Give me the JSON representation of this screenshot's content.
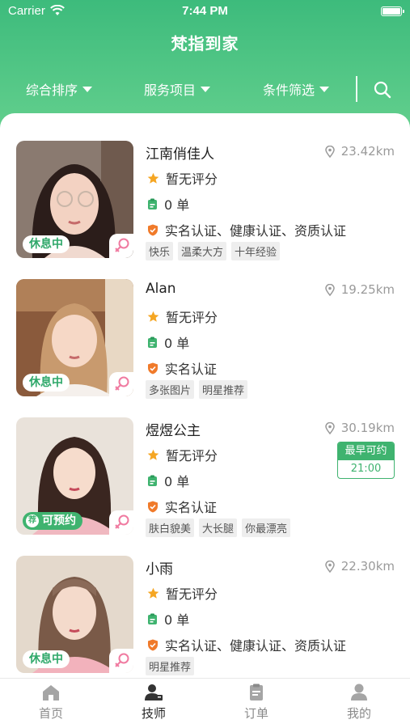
{
  "status_bar": {
    "carrier": "Carrier",
    "time": "7:44 PM"
  },
  "app_title": "梵指到家",
  "filters": {
    "sort": "综合排序",
    "service": "服务项目",
    "conditions": "条件筛选"
  },
  "technicians": [
    {
      "name": "江南俏佳人",
      "distance": "23.42km",
      "rating": "暂无评分",
      "orders": "0 单",
      "certs": "实名认证、健康认证、资质认证",
      "tags": [
        "快乐",
        "温柔大方",
        "十年经验"
      ],
      "status": "休息中"
    },
    {
      "name": "Alan",
      "distance": "19.25km",
      "rating": "暂无评分",
      "orders": "0 单",
      "certs": "实名认证",
      "tags": [
        "多张图片",
        "明星推荐"
      ],
      "status": "休息中"
    },
    {
      "name": "煜煜公主",
      "distance": "30.19km",
      "rating": "暂无评分",
      "orders": "0 单",
      "certs": "实名认证",
      "tags": [
        "肤白貌美",
        "大长腿",
        "你最漂亮"
      ],
      "status": "可预约",
      "status_icon": "荐",
      "earliest_label": "最早可约",
      "earliest_time": "21:00"
    },
    {
      "name": "小雨",
      "distance": "22.30km",
      "rating": "暂无评分",
      "orders": "0 单",
      "certs": "实名认证、健康认证、资质认证",
      "tags": [
        "明星推荐"
      ],
      "status": "休息中"
    }
  ],
  "tabs": [
    {
      "label": "首页",
      "icon": "home-icon"
    },
    {
      "label": "技师",
      "icon": "technician-icon",
      "active": true
    },
    {
      "label": "订单",
      "icon": "order-icon"
    },
    {
      "label": "我的",
      "icon": "profile-icon"
    }
  ],
  "colors": {
    "brand": "#3dbb7c",
    "female_icon": "#f07aa0",
    "star": "#f5a623",
    "shield": "#f07a2a"
  }
}
